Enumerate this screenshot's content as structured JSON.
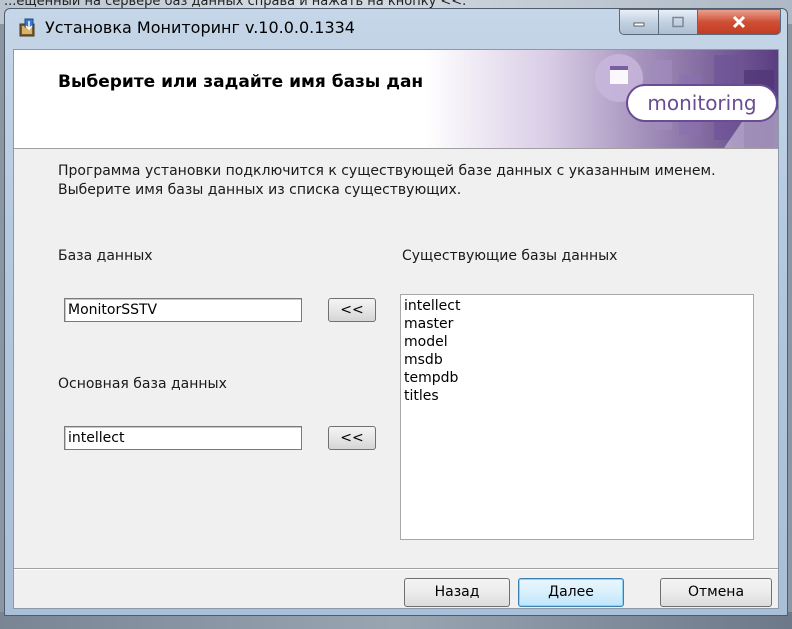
{
  "background": {
    "top_text": "...ещённый на сервере баз данных справа и нажать на кнопку <<.",
    "accent": "#8c96a3"
  },
  "window": {
    "title": "Установка Мониторинг v.10.0.0.1334",
    "controls": {
      "minimize": "minimize-icon",
      "maximize": "maximize-icon",
      "close": "close-icon"
    }
  },
  "header": {
    "title": "Выберите или задайте имя базы данных.",
    "logo_text": "monitoring",
    "accent": "#6a4c93"
  },
  "description": {
    "line1": "Программа установки подключится к существующей базе данных с указанным именем.",
    "line2": "Выберите имя базы данных из списка существующих."
  },
  "form": {
    "database_label": "База данных",
    "database_value": "MonitorSSTV",
    "main_database_label": "Основная база данных",
    "main_database_value": "intellect",
    "copy_button_label": "<<",
    "existing_label": "Существующие базы данных",
    "existing_databases": [
      "intellect",
      "master",
      "model",
      "msdb",
      "tempdb",
      "titles"
    ]
  },
  "footer": {
    "back_label": "Назад",
    "next_label": "Далее",
    "cancel_label": "Отмена"
  }
}
